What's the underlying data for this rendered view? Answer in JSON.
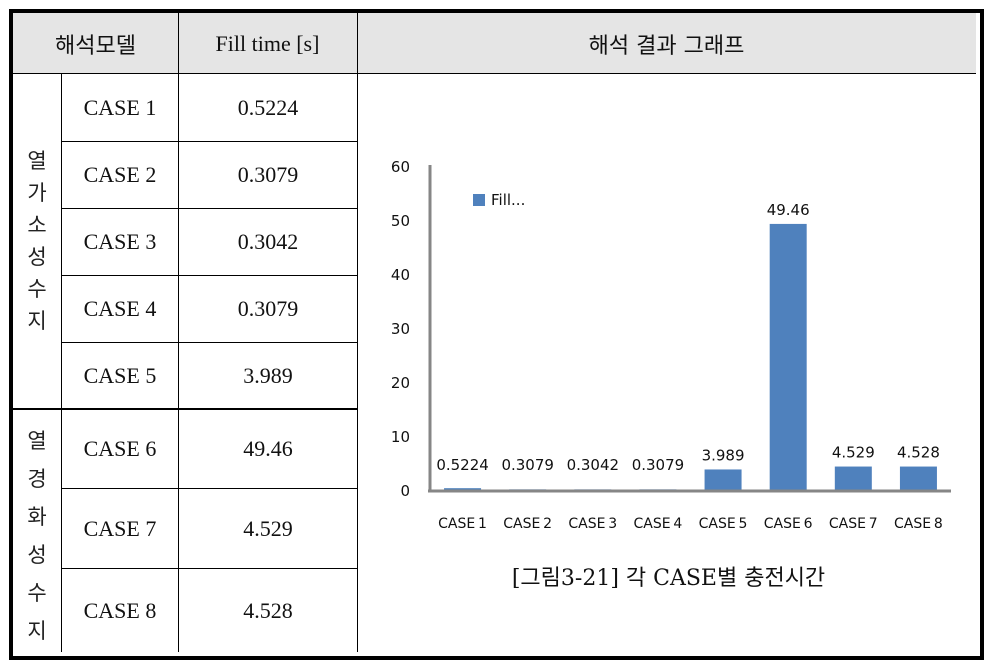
{
  "table": {
    "headers": {
      "model": "해석모델",
      "fill_time": "Fill time [s]",
      "graph": "해석 결과 그래프"
    },
    "groups": [
      {
        "label_chars": [
          "열",
          "가",
          "소",
          "성",
          "수",
          "지"
        ],
        "label": "열가소성수지",
        "rows": [
          {
            "case": "CASE 1",
            "fill_time": "0.5224"
          },
          {
            "case": "CASE 2",
            "fill_time": "0.3079"
          },
          {
            "case": "CASE 3",
            "fill_time": "0.3042"
          },
          {
            "case": "CASE 4",
            "fill_time": "0.3079"
          },
          {
            "case": "CASE 5",
            "fill_time": "3.989"
          }
        ]
      },
      {
        "label_chars": [
          "열",
          "경",
          "화",
          "성",
          "수",
          "지"
        ],
        "label": "열경화성수지",
        "rows": [
          {
            "case": "CASE 6",
            "fill_time": "49.46"
          },
          {
            "case": "CASE 7",
            "fill_time": "4.529"
          },
          {
            "case": "CASE 8",
            "fill_time": "4.528"
          }
        ]
      }
    ]
  },
  "caption": "[그림3-21] 각 CASE별 충전시간",
  "colors": {
    "bar": "#4f81bd",
    "axis": "#868686",
    "header_bg": "#e5e5e5"
  },
  "chart_data": {
    "type": "bar",
    "title": "",
    "xlabel": "",
    "ylabel": "",
    "categories": [
      "CASE 1",
      "CASE 2",
      "CASE 3",
      "CASE 4",
      "CASE 5",
      "CASE 6",
      "CASE 7",
      "CASE 8"
    ],
    "series": [
      {
        "name": "Fill...",
        "values": [
          0.5224,
          0.3079,
          0.3042,
          0.3079,
          3.989,
          49.46,
          4.529,
          4.528
        ]
      }
    ],
    "data_labels": [
      "0.5224",
      "0.3079",
      "0.3042",
      "0.3079",
      "3.989",
      "49.46",
      "4.529",
      "4.528"
    ],
    "yticks": [
      0,
      10,
      20,
      30,
      40,
      50,
      60
    ],
    "ylim": [
      0,
      60
    ],
    "grid": false,
    "legend": {
      "entries": [
        "Fill..."
      ],
      "placement": "top-left"
    }
  }
}
